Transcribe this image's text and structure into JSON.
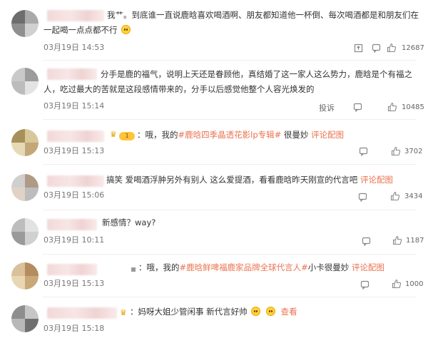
{
  "comments": [
    {
      "text_line1": "我艹。到底谁一直说鹿晗喜欢喝酒啊、朋友都知道他一杯倒、每次喝酒都是和朋友们在",
      "text_line2": "一起喝一点点都不行",
      "time": "03月19日 14:53",
      "likes": "12687"
    },
    {
      "text_line1": "分手是鹿的福气，说明上天还是眷顾他，真结婚了这一家人这么势力，鹿晗是个有福之",
      "text_line2": "人，吃过最大的苦就是这段感情带来的，分手以后感觉他整个人容光焕发的",
      "time": "03月19日 15:14",
      "report": "投诉",
      "likes": "10485"
    },
    {
      "badge": "1",
      "prefix": "：哦，我的",
      "highlight": "#鹿晗四季晶透花影lp专辑#",
      "suffix": " 很曼妙 ",
      "link": "评论配图",
      "time": "03月19日 15:13",
      "likes": "3702"
    },
    {
      "text": "搞笑 爱喝酒浮肿另外有别人 这么爱提酒，看看鹿晗昨天刚宣的代言吧 ",
      "link": "评论配图",
      "time": "03月19日 15:06",
      "likes": "3434"
    },
    {
      "text": "新感情？way?",
      "time": "03月19日 10:11",
      "likes": "1187"
    },
    {
      "prefix": "：哦，我的",
      "highlight": "#鹿晗鲜啤福鹿家品牌全球代言人#",
      "suffix": "小卡很曼妙 ",
      "link": "评论配图",
      "time": "03月19日 15:13",
      "likes": "1000"
    },
    {
      "text": "：妈呀大姐少管闲事 新代言好帅",
      "link": "查看",
      "time": "03月19日 15:18"
    }
  ],
  "colors": {
    "highlight": "#eb7350",
    "text": "#333333",
    "meta": "#777777"
  },
  "icons": {
    "share": "share-icon",
    "comment": "comment-icon",
    "like": "like-icon"
  }
}
